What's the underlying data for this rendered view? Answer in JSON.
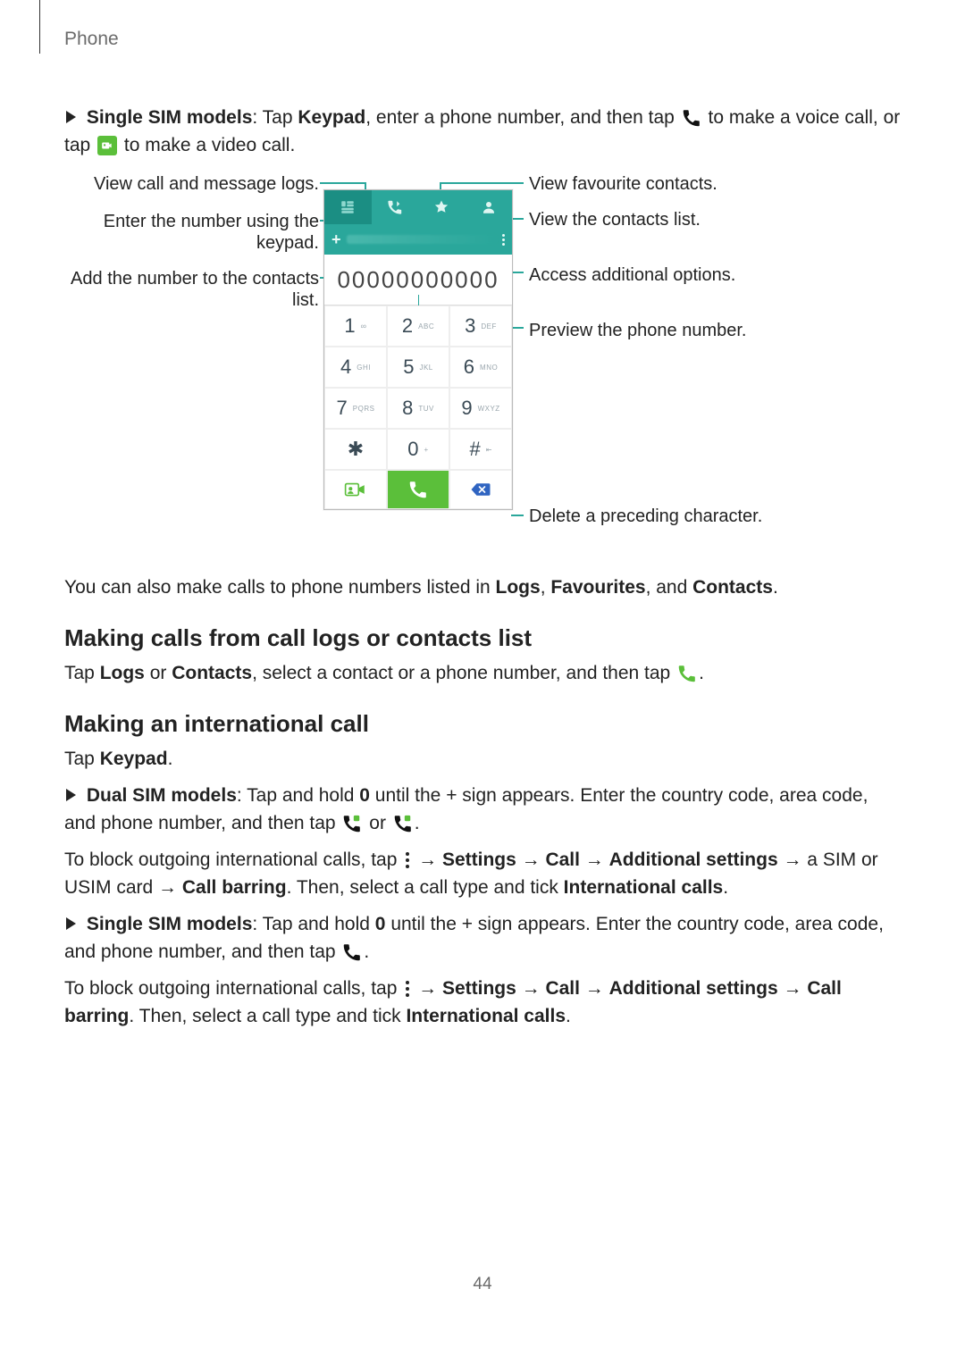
{
  "header": {
    "section": "Phone"
  },
  "intro": {
    "bullet_prefix": "Single SIM models",
    "text_before_keypad": ": Tap ",
    "keypad_word": "Keypad",
    "text_after_keypad": ", enter a phone number, and then tap ",
    "text_after_phone_icon": " to make a voice call, or tap ",
    "text_after_video_icon": " to make a video call."
  },
  "callouts": {
    "left": [
      "View call and message logs.",
      "Enter the number using the keypad.",
      "Add the number to the contacts list."
    ],
    "right": [
      "View favourite contacts.",
      "View the contacts list.",
      "Access additional options.",
      "Preview the phone number.",
      "Delete a preceding character."
    ]
  },
  "phone_ui": {
    "number_entered": "00000000000",
    "keys": [
      {
        "digit": "1",
        "sub": ""
      },
      {
        "digit": "2",
        "sub": "ABC"
      },
      {
        "digit": "3",
        "sub": "DEF"
      },
      {
        "digit": "4",
        "sub": "GHI"
      },
      {
        "digit": "5",
        "sub": "JKL"
      },
      {
        "digit": "6",
        "sub": "MNO"
      },
      {
        "digit": "7",
        "sub": "PQRS"
      },
      {
        "digit": "8",
        "sub": "TUV"
      },
      {
        "digit": "9",
        "sub": "WXYZ"
      },
      {
        "digit": "✱",
        "sub": ""
      },
      {
        "digit": "0",
        "sub": "+"
      },
      {
        "digit": "#",
        "sub": ""
      }
    ]
  },
  "after_diagram": {
    "line": "You can also make calls to phone numbers listed in ",
    "logs": "Logs",
    "sep1": ", ",
    "favourites": "Favourites",
    "sep2": ", and ",
    "contacts": "Contacts",
    "end": "."
  },
  "section1": {
    "heading": "Making calls from call logs or contacts list",
    "body_before": "Tap ",
    "logs": "Logs",
    "or": " or ",
    "contacts": "Contacts",
    "after": ", select a contact or a phone number, and then tap ",
    "end": "."
  },
  "section2": {
    "heading": "Making an international call",
    "tap_keypad_before": "Tap ",
    "tap_keypad_word": "Keypad",
    "tap_keypad_end": ".",
    "dual": {
      "label": "Dual SIM models",
      "before0": ": Tap and hold ",
      "zero": "0",
      "after0": " until the + sign appears. Enter the country code, area code, and phone number, and then tap ",
      "or": " or ",
      "end": "."
    },
    "block_dual": {
      "before": "To block outgoing international calls, tap ",
      "arrow1": " → ",
      "settings": "Settings",
      "call": "Call",
      "addl": "Additional settings",
      "sim": " → a SIM or USIM card → ",
      "barring": "Call barring",
      "then": ". Then, select a call type and tick ",
      "intl": "International calls",
      "end": "."
    },
    "single": {
      "label": "Single SIM models",
      "before0": ": Tap and hold ",
      "zero": "0",
      "after0": " until the + sign appears. Enter the country code, area code, and phone number, and then tap ",
      "end": "."
    },
    "block_single": {
      "before": "To block outgoing international calls, tap ",
      "arrow1": " → ",
      "settings": "Settings",
      "call": "Call",
      "addl": "Additional settings",
      "barring": "Call barring",
      "then": ". Then, select a call type and tick ",
      "intl": "International calls",
      "end": "."
    }
  },
  "page_number": "44"
}
